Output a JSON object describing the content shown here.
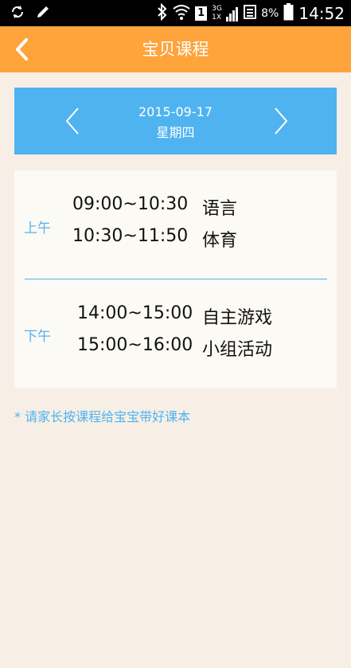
{
  "status_bar": {
    "battery_percent": "8%",
    "time": "14:52",
    "network_top": "3G",
    "network_bottom": "1X",
    "sim": "1"
  },
  "header": {
    "title": "宝贝课程"
  },
  "date_bar": {
    "date": "2015-09-17",
    "weekday": "星期四"
  },
  "schedule": {
    "morning": {
      "label": "上午",
      "rows": [
        {
          "time": "09:00~10:30",
          "subject": "语言"
        },
        {
          "time": "10:30~11:50",
          "subject": "体育"
        }
      ]
    },
    "afternoon": {
      "label": "下午",
      "rows": [
        {
          "time": "14:00~15:00",
          "subject": "自主游戏"
        },
        {
          "time": "15:00~16:00",
          "subject": "小组活动"
        }
      ]
    }
  },
  "notice": "* 请家长按课程给宝宝带好课本",
  "colors": {
    "header": "#ffa33b",
    "accent_blue": "#4fb3f0",
    "background": "#f7efe6",
    "card": "#fcfaf4"
  }
}
